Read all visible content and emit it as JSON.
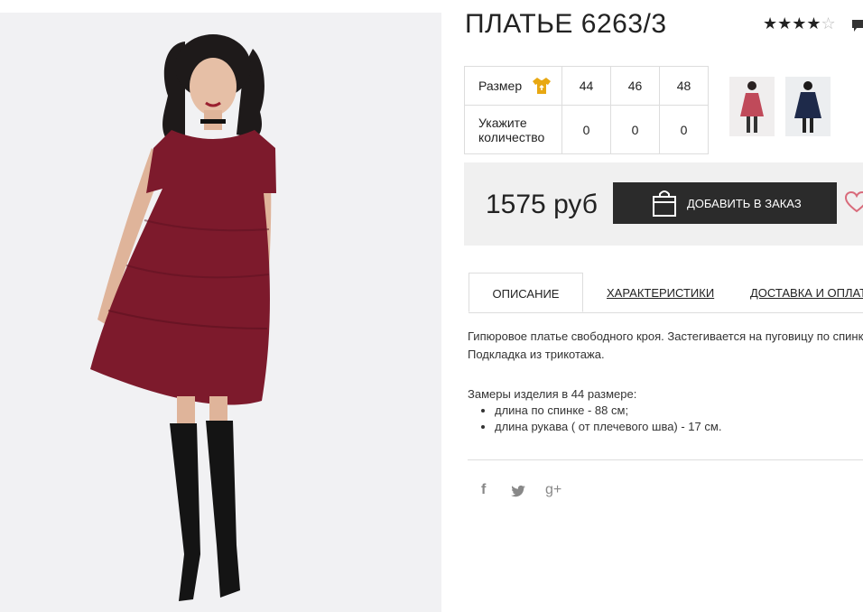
{
  "product": {
    "title": "ПЛАТЬЕ 6263/3",
    "rating_stars": "★★★★",
    "rating_half": "☆"
  },
  "sizes": {
    "size_label": "Размер",
    "quantity_label": "Укажите количество",
    "columns": [
      "44",
      "46",
      "48"
    ],
    "quantities": [
      "0",
      "0",
      "0"
    ]
  },
  "buy": {
    "price": "1575 руб",
    "add_button_label": "ДОБАВИТЬ В ЗАКАЗ"
  },
  "tabs": {
    "description": "ОПИСАНИЕ",
    "characteristics": "ХАРАКТЕРИСТИКИ",
    "delivery": "ДОСТАВКА И ОПЛАТА"
  },
  "description": {
    "line1": "Гипюровое платье свободного кроя. Застегивается на пуговицу по спинке.",
    "line2": "Подкладка из трикотажа.",
    "measures_title": "Замеры изделия в 44 размере:",
    "measure1": "длина по спинке - 88 см;",
    "measure2": "длина рукава ( от плечевого шва) - 17 см."
  },
  "social": {
    "facebook": "f",
    "twitter": "🐦",
    "gplus": "g+"
  },
  "colors": {
    "dress": "#7d1a2c",
    "button": "#2b2b2b",
    "accent_icon": "#e8a812"
  },
  "icons": [
    "shirt-icon",
    "bag-icon",
    "heart-icon",
    "comment-icon",
    "facebook-icon",
    "twitter-icon",
    "google-plus-icon"
  ]
}
